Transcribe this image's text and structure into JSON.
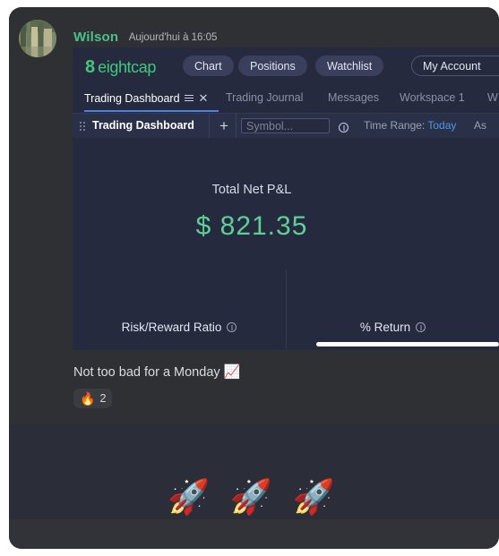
{
  "message": {
    "author": "Wilson",
    "timestamp": "Aujourd'hui à 16:05",
    "author_color": "#4ac08a",
    "text": "Not too bad for a Monday",
    "text_emoji": "📈",
    "reaction": {
      "emoji": "🔥",
      "count": "2"
    },
    "attachment_emojis": "🚀 🚀 🚀",
    "avatar_name": "avatar"
  },
  "embed": {
    "app": {
      "logo_mark": "8",
      "logo_text": "eightcap",
      "logo_color": "#3ec97d",
      "nav": [
        {
          "label": "Chart"
        },
        {
          "label": "Positions"
        },
        {
          "label": "Watchlist"
        }
      ],
      "account_button": {
        "label": "My Account",
        "caret": "▾"
      }
    },
    "tabs": [
      {
        "label": "Trading Dashboard",
        "active": true
      },
      {
        "label": "Trading Journal",
        "active": false
      },
      {
        "label": "Messages",
        "active": false
      },
      {
        "label": "Workspace 1",
        "active": false
      },
      {
        "label": "W",
        "active": false
      }
    ],
    "active_tab_underline_color": "#4a82e8",
    "toolbar": {
      "title": "Trading Dashboard",
      "add_label": "+",
      "symbol_placeholder": "Symbol...",
      "info_label": "ⓘ",
      "time_range_prefix": "Time Range:",
      "time_range_value": "Today",
      "time_range_value_color": "#4a9ae8",
      "clipped_label": "As"
    },
    "pl": {
      "label": "Total Net P&L",
      "value": "$ 821.35",
      "value_color": "#5fcf98"
    },
    "stats": [
      {
        "label": "Risk/Reward Ratio"
      },
      {
        "label": "% Return"
      }
    ]
  }
}
